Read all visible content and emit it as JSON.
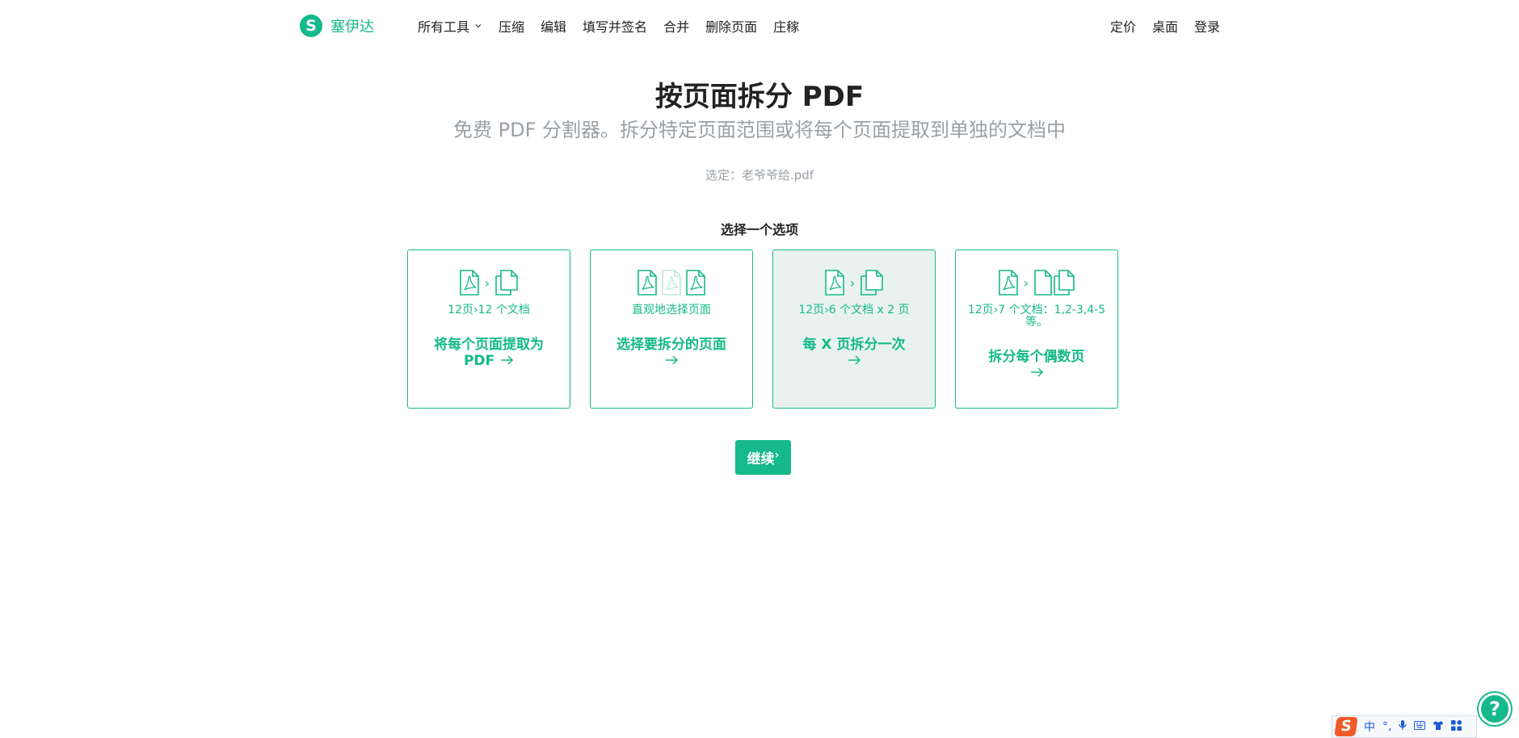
{
  "brand": {
    "logo_letter": "S",
    "name": "塞伊达"
  },
  "nav": {
    "items": [
      {
        "label": "所有工具"
      },
      {
        "label": "压缩"
      },
      {
        "label": "编辑"
      },
      {
        "label": "填写并签名"
      },
      {
        "label": "合并"
      },
      {
        "label": "删除页面"
      },
      {
        "label": "庄稼"
      }
    ],
    "right": [
      {
        "label": "定价"
      },
      {
        "label": "桌面"
      },
      {
        "label": "登录"
      }
    ]
  },
  "hero": {
    "title": "按页面拆分 PDF",
    "subtitle": "免费 PDF 分割器。拆分特定页面范围或将每个页面提取到单独的文档中",
    "selected": "选定：老爷爷给.pdf"
  },
  "options": {
    "heading": "选择一个选项",
    "cards": [
      {
        "desc": "12页›12 个文档",
        "label_line1": "将每个页面提取为",
        "label_line2": "PDF",
        "selected": false
      },
      {
        "desc": "直观地选择页面",
        "label_line1": "选择要拆分的页面",
        "label_line2": "",
        "selected": false
      },
      {
        "desc": "12页›6 个文档 x 2 页",
        "label_line1": "每 X 页拆分一次",
        "label_line2": "",
        "selected": true
      },
      {
        "desc": "12页›7 个文档：1,2-3,4-5 等。",
        "label_line1": "拆分每个偶数页",
        "label_line2": "",
        "selected": false
      }
    ]
  },
  "continue_label": "继续",
  "help_label": "?",
  "ime": {
    "logo": "S",
    "mode": "中"
  },
  "colors": {
    "accent": "#15b98a",
    "selected_bg": "#eaf2ef",
    "muted": "#9aa0a6"
  }
}
